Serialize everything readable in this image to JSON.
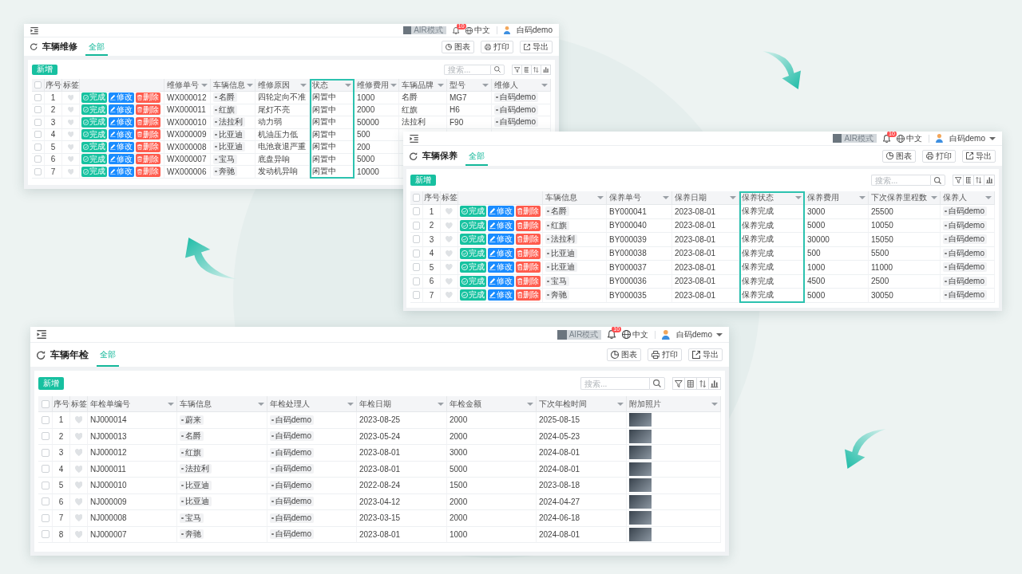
{
  "windows": [
    {
      "topbar": {
        "mode_switch": {
          "label": "AIR模式",
          "on": false
        },
        "notifications": "10",
        "language": "中文",
        "user": "白码demo",
        "caret": false
      },
      "title": "车辆维修",
      "tabs": [
        {
          "label": "全部",
          "selected": true
        }
      ],
      "header_buttons": [
        "图表",
        "打印",
        "导出"
      ],
      "add_button": "新增",
      "search": {
        "placeholder": "搜索..."
      },
      "table": {
        "header_checkbox": {
          "checked": false
        },
        "index_label": "序号",
        "mark_label": "标签",
        "columns": [
          {
            "kind": "text",
            "label": "维修单号"
          },
          {
            "kind": "chip",
            "label": "车辆信息"
          },
          {
            "kind": "text",
            "label": "维修原因"
          },
          {
            "kind": "text",
            "label": "状态",
            "highlighted": true
          },
          {
            "kind": "text",
            "label": "维修费用"
          },
          {
            "kind": "text",
            "label": "车辆品牌"
          },
          {
            "kind": "text",
            "label": "型号"
          },
          {
            "kind": "chip",
            "label": "维修人"
          }
        ],
        "rows": [
          {
            "checked": false,
            "index": "1",
            "favorite": false,
            "actions": [
              {
                "kind": "complete",
                "label": "完成"
              },
              {
                "kind": "edit",
                "label": "修改"
              },
              {
                "kind": "delete",
                "label": "删除"
              }
            ],
            "cells": [
              "WX000012",
              "名爵",
              "四轮定向不准",
              "闲置中",
              "1000",
              "名爵",
              "MG7",
              "白码demo"
            ]
          },
          {
            "checked": false,
            "index": "2",
            "favorite": false,
            "actions": [
              {
                "kind": "complete",
                "label": "完成"
              },
              {
                "kind": "edit",
                "label": "修改"
              },
              {
                "kind": "delete",
                "label": "删除"
              }
            ],
            "cells": [
              "WX000011",
              "红旗",
              "尾灯不亮",
              "闲置中",
              "2000",
              "红旗",
              "H6",
              "白码demo"
            ]
          },
          {
            "checked": false,
            "index": "3",
            "favorite": false,
            "actions": [
              {
                "kind": "complete",
                "label": "完成"
              },
              {
                "kind": "edit",
                "label": "修改"
              },
              {
                "kind": "delete",
                "label": "删除"
              }
            ],
            "cells": [
              "WX000010",
              "法拉利",
              "动力弱",
              "闲置中",
              "50000",
              "法拉利",
              "F90",
              "白码demo"
            ]
          },
          {
            "checked": false,
            "index": "4",
            "favorite": false,
            "actions": [
              {
                "kind": "complete",
                "label": "完成"
              },
              {
                "kind": "edit",
                "label": "修改"
              },
              {
                "kind": "delete",
                "label": "删除"
              }
            ],
            "cells": [
              "WX000009",
              "比亚迪",
              "机油压力低",
              "闲置中",
              "500"
            ]
          },
          {
            "checked": false,
            "index": "5",
            "favorite": false,
            "actions": [
              {
                "kind": "complete",
                "label": "完成"
              },
              {
                "kind": "edit",
                "label": "修改"
              },
              {
                "kind": "delete",
                "label": "删除"
              }
            ],
            "cells": [
              "WX000008",
              "比亚迪",
              "电池衰退严重",
              "闲置中",
              "200"
            ]
          },
          {
            "checked": false,
            "index": "6",
            "favorite": false,
            "actions": [
              {
                "kind": "complete",
                "label": "完成"
              },
              {
                "kind": "edit",
                "label": "修改"
              },
              {
                "kind": "delete",
                "label": "删除"
              }
            ],
            "cells": [
              "WX000007",
              "宝马",
              "底盘异响",
              "闲置中",
              "5000"
            ]
          },
          {
            "checked": false,
            "index": "7",
            "favorite": false,
            "actions": [
              {
                "kind": "complete",
                "label": "完成"
              },
              {
                "kind": "edit",
                "label": "修改"
              },
              {
                "kind": "delete",
                "label": "删除"
              }
            ],
            "cells": [
              "WX000006",
              "奔驰",
              "发动机异响",
              "闲置中",
              "10000"
            ]
          }
        ]
      }
    },
    {
      "topbar": {
        "mode_switch": {
          "label": "AIR模式",
          "on": false
        },
        "notifications": "10",
        "language": "中文",
        "user": "白码demo",
        "caret": true
      },
      "title": "车辆保养",
      "tabs": [
        {
          "label": "全部",
          "selected": true
        }
      ],
      "header_buttons": [
        "图表",
        "打印",
        "导出"
      ],
      "add_button": "新增",
      "search": {
        "placeholder": "搜索..."
      },
      "table": {
        "header_checkbox": {
          "checked": false
        },
        "index_label": "序号",
        "mark_label": "标签",
        "columns": [
          {
            "kind": "chip",
            "label": "车辆信息"
          },
          {
            "kind": "text",
            "label": "保养单号"
          },
          {
            "kind": "text",
            "label": "保养日期"
          },
          {
            "kind": "text",
            "label": "保养状态",
            "highlighted": true
          },
          {
            "kind": "text",
            "label": "保养费用"
          },
          {
            "kind": "text",
            "label": "下次保养里程数"
          },
          {
            "kind": "chip",
            "label": "保养人"
          }
        ],
        "rows": [
          {
            "checked": false,
            "index": "1",
            "favorite": false,
            "actions": [
              {
                "kind": "complete",
                "label": "完成"
              },
              {
                "kind": "edit",
                "label": "修改"
              },
              {
                "kind": "delete",
                "label": "删除"
              }
            ],
            "cells": [
              "名爵",
              "BY000041",
              "2023-08-01",
              "保养完成",
              "3000",
              "25500",
              "白码demo"
            ]
          },
          {
            "checked": false,
            "index": "2",
            "favorite": false,
            "actions": [
              {
                "kind": "complete",
                "label": "完成"
              },
              {
                "kind": "edit",
                "label": "修改"
              },
              {
                "kind": "delete",
                "label": "删除"
              }
            ],
            "cells": [
              "红旗",
              "BY000040",
              "2023-08-01",
              "保养完成",
              "5000",
              "10050",
              "白码demo"
            ]
          },
          {
            "checked": false,
            "index": "3",
            "favorite": false,
            "actions": [
              {
                "kind": "complete",
                "label": "完成"
              },
              {
                "kind": "edit",
                "label": "修改"
              },
              {
                "kind": "delete",
                "label": "删除"
              }
            ],
            "cells": [
              "法拉利",
              "BY000039",
              "2023-08-01",
              "保养完成",
              "30000",
              "15050",
              "白码demo"
            ]
          },
          {
            "checked": false,
            "index": "4",
            "favorite": false,
            "actions": [
              {
                "kind": "complete",
                "label": "完成"
              },
              {
                "kind": "edit",
                "label": "修改"
              },
              {
                "kind": "delete",
                "label": "删除"
              }
            ],
            "cells": [
              "比亚迪",
              "BY000038",
              "2023-08-01",
              "保养完成",
              "500",
              "5500",
              "白码demo"
            ]
          },
          {
            "checked": false,
            "index": "5",
            "favorite": false,
            "actions": [
              {
                "kind": "complete",
                "label": "完成"
              },
              {
                "kind": "edit",
                "label": "修改"
              },
              {
                "kind": "delete",
                "label": "删除"
              }
            ],
            "cells": [
              "比亚迪",
              "BY000037",
              "2023-08-01",
              "保养完成",
              "1000",
              "11000",
              "白码demo"
            ]
          },
          {
            "checked": false,
            "index": "6",
            "favorite": false,
            "actions": [
              {
                "kind": "complete",
                "label": "完成"
              },
              {
                "kind": "edit",
                "label": "修改"
              },
              {
                "kind": "delete",
                "label": "删除"
              }
            ],
            "cells": [
              "宝马",
              "BY000036",
              "2023-08-01",
              "保养完成",
              "4500",
              "2500",
              "白码demo"
            ]
          },
          {
            "checked": false,
            "index": "7",
            "favorite": false,
            "actions": [
              {
                "kind": "complete",
                "label": "完成"
              },
              {
                "kind": "edit",
                "label": "修改"
              },
              {
                "kind": "delete",
                "label": "删除"
              }
            ],
            "cells": [
              "奔驰",
              "BY000035",
              "2023-08-01",
              "保养完成",
              "5000",
              "30050",
              "白码demo"
            ]
          }
        ]
      }
    },
    {
      "topbar": {
        "mode_switch": {
          "label": "AIR模式",
          "on": false
        },
        "notifications": "10",
        "language": "中文",
        "user": "白码demo",
        "caret": true
      },
      "title": "车辆年检",
      "tabs": [
        {
          "label": "全部",
          "selected": true
        }
      ],
      "header_buttons": [
        "图表",
        "打印",
        "导出"
      ],
      "add_button": "新增",
      "search": {
        "placeholder": "搜索..."
      },
      "table": {
        "header_checkbox": {
          "checked": false
        },
        "index_label": "序号",
        "mark_label": "标签",
        "columns": [
          {
            "kind": "text",
            "label": "年检单编号"
          },
          {
            "kind": "chip",
            "label": "车辆信息"
          },
          {
            "kind": "chip",
            "label": "年检处理人"
          },
          {
            "kind": "text",
            "label": "年检日期"
          },
          {
            "kind": "text",
            "label": "年检金额"
          },
          {
            "kind": "text",
            "label": "下次年检时间"
          },
          {
            "kind": "photo",
            "label": "附加照片"
          }
        ],
        "rows": [
          {
            "checked": false,
            "index": "1",
            "favorite": false,
            "cells": [
              "NJ000014",
              "蔚来",
              "白码demo",
              "2023-08-25",
              "2000",
              "2025-08-15"
            ],
            "photo": true
          },
          {
            "checked": false,
            "index": "2",
            "favorite": false,
            "cells": [
              "NJ000013",
              "名爵",
              "白码demo",
              "2023-05-24",
              "2000",
              "2024-05-23"
            ],
            "photo": true
          },
          {
            "checked": false,
            "index": "3",
            "favorite": false,
            "cells": [
              "NJ000012",
              "红旗",
              "白码demo",
              "2023-08-01",
              "3000",
              "2024-08-01"
            ],
            "photo": true
          },
          {
            "checked": false,
            "index": "4",
            "favorite": false,
            "cells": [
              "NJ000011",
              "法拉利",
              "白码demo",
              "2023-08-01",
              "5000",
              "2024-08-01"
            ],
            "photo": true
          },
          {
            "checked": false,
            "index": "5",
            "favorite": false,
            "cells": [
              "NJ000010",
              "比亚迪",
              "白码demo",
              "2022-08-24",
              "1500",
              "2023-08-18"
            ],
            "photo": true
          },
          {
            "checked": false,
            "index": "6",
            "favorite": false,
            "cells": [
              "NJ000009",
              "比亚迪",
              "白码demo",
              "2023-04-12",
              "2000",
              "2024-04-27"
            ],
            "photo": true
          },
          {
            "checked": false,
            "index": "7",
            "favorite": false,
            "cells": [
              "NJ000008",
              "宝马",
              "白码demo",
              "2023-03-15",
              "2000",
              "2024-06-18"
            ],
            "photo": true
          },
          {
            "checked": false,
            "index": "8",
            "favorite": false,
            "cells": [
              "NJ000007",
              "奔驰",
              "白码demo",
              "2023-08-01",
              "1000",
              "2024-08-01"
            ],
            "photo": true
          }
        ]
      }
    }
  ]
}
